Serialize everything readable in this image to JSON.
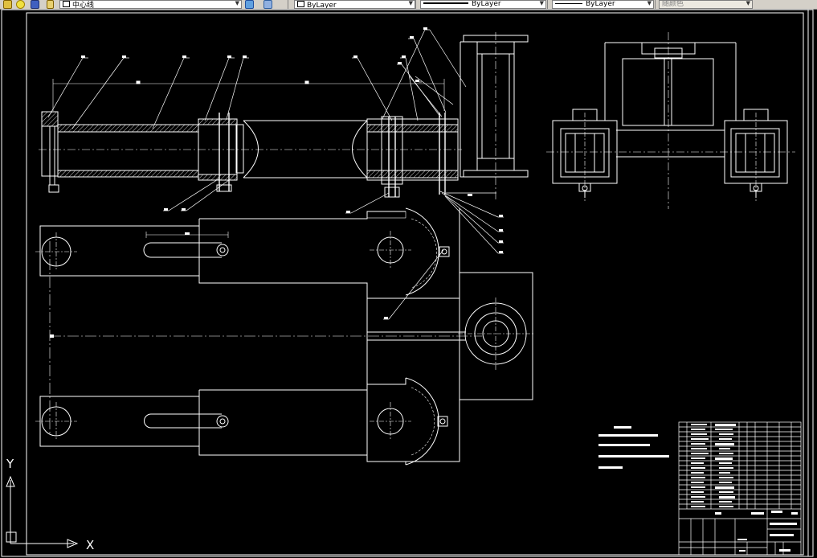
{
  "toolbar": {
    "layer_combo": {
      "value": "中心线",
      "icon": "lightbulb-sun-icon"
    },
    "color_combo": {
      "value": "ByLayer"
    },
    "linetype_combo": {
      "value": "ByLayer"
    },
    "lineweight_combo": {
      "value": "ByLayer"
    },
    "plotstyle_combo": {
      "value": "随颜色"
    },
    "layer_tools": [
      "layer-previous-icon",
      "layer-states-icon"
    ]
  },
  "colors": {
    "background": "#000000",
    "line": "#ffffff",
    "toolbar": "#d4d0c8"
  },
  "ucs": {
    "x_label": "X",
    "y_label": "Y"
  },
  "drawing": {
    "part_labels_note": "balloon leader labels are unreadable in source; rendered as marks"
  }
}
